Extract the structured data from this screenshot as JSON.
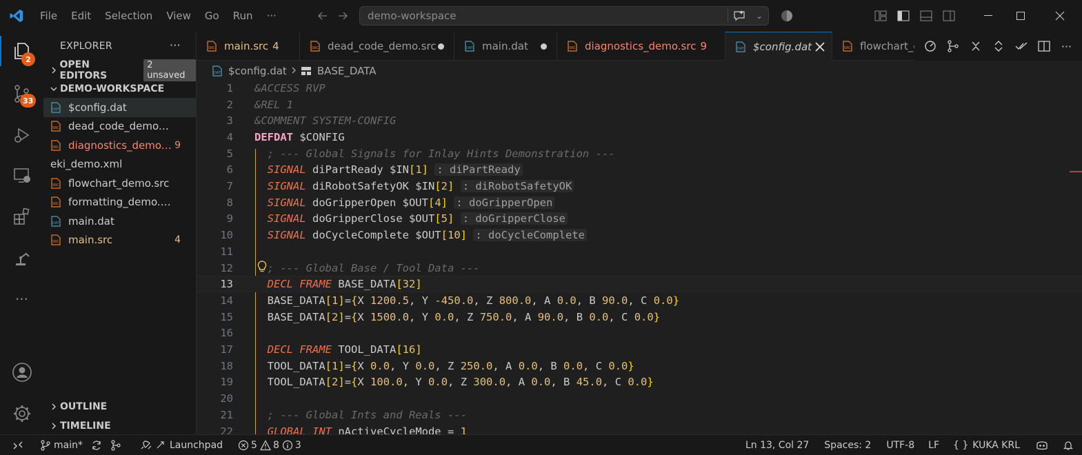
{
  "titlebar": {
    "menu": [
      "File",
      "Edit",
      "Selection",
      "View",
      "Go",
      "Run",
      "···"
    ],
    "search_text": "demo-workspace"
  },
  "activity": {
    "explorer_badge": "2",
    "scm_badge": "33"
  },
  "sidebar": {
    "title": "EXPLORER",
    "more": "···",
    "open_editors": "OPEN EDITORS",
    "unsaved": "2 unsaved",
    "workspace": "DEMO-WORKSPACE",
    "files": [
      {
        "name": "$config.dat",
        "type": "dat",
        "state": "sel",
        "count": ""
      },
      {
        "name": "dead_code_demo.src",
        "type": "src",
        "state": "",
        "count": ""
      },
      {
        "name": "diagnostics_demo....",
        "type": "src",
        "state": "err",
        "count": "9"
      },
      {
        "name": "eki_demo.xml",
        "type": "none",
        "state": "",
        "count": ""
      },
      {
        "name": "flowchart_demo.src",
        "type": "src",
        "state": "",
        "count": ""
      },
      {
        "name": "formatting_demo.src",
        "type": "src",
        "state": "",
        "count": ""
      },
      {
        "name": "main.dat",
        "type": "dat",
        "state": "",
        "count": ""
      },
      {
        "name": "main.src",
        "type": "src",
        "state": "mod",
        "count": "4"
      }
    ],
    "outline": "OUTLINE",
    "timeline": "TIMELINE"
  },
  "tabs": [
    {
      "label": "main.src",
      "type": "src",
      "state": "mod",
      "count": "4",
      "dirty": false
    },
    {
      "label": "dead_code_demo.src",
      "type": "src",
      "state": "",
      "count": "",
      "dirty": true
    },
    {
      "label": "main.dat",
      "type": "dat",
      "state": "",
      "count": "",
      "dirty": true
    },
    {
      "label": "diagnostics_demo.src",
      "type": "src",
      "state": "err",
      "count": "9",
      "dirty": false
    },
    {
      "label": "$config.dat",
      "type": "dat",
      "state": "active",
      "count": "",
      "dirty": false
    },
    {
      "label": "flowchart_c",
      "type": "src",
      "state": "",
      "count": "",
      "dirty": false
    }
  ],
  "breadcrumb": {
    "file": "$config.dat",
    "symbol": "BASE_DATA"
  },
  "editor": {
    "current_line": 13,
    "lines": [
      {
        "n": "1",
        "tokens": [
          [
            "c-com",
            "&ACCESS RVP"
          ]
        ]
      },
      {
        "n": "2",
        "tokens": [
          [
            "c-com",
            "&REL 1"
          ]
        ]
      },
      {
        "n": "3",
        "tokens": [
          [
            "c-com",
            "&COMMENT SYSTEM-CONFIG"
          ]
        ]
      },
      {
        "n": "4",
        "tokens": [
          [
            "c-kw",
            "DEFDAT"
          ],
          [
            "c-plain",
            " $CONFIG"
          ]
        ]
      },
      {
        "n": "5",
        "tokens": [
          [
            "c-com",
            "  ; --- Global Signals for Inlay Hints Demonstration ---"
          ]
        ]
      },
      {
        "n": "6",
        "tokens": [
          [
            "c-plain",
            "  "
          ],
          [
            "c-key",
            "SIGNAL"
          ],
          [
            "c-plain",
            " diPartReady $IN"
          ],
          [
            "c-br",
            "["
          ],
          [
            "c-num",
            "1"
          ],
          [
            "c-br",
            "]"
          ],
          [
            "c-plain",
            " "
          ],
          [
            "c-hint",
            ": diPartReady"
          ]
        ]
      },
      {
        "n": "7",
        "tokens": [
          [
            "c-plain",
            "  "
          ],
          [
            "c-key",
            "SIGNAL"
          ],
          [
            "c-plain",
            " diRobotSafetyOK $IN"
          ],
          [
            "c-br",
            "["
          ],
          [
            "c-num",
            "2"
          ],
          [
            "c-br",
            "]"
          ],
          [
            "c-plain",
            " "
          ],
          [
            "c-hint",
            ": diRobotSafetyOK"
          ]
        ]
      },
      {
        "n": "8",
        "tokens": [
          [
            "c-plain",
            "  "
          ],
          [
            "c-key",
            "SIGNAL"
          ],
          [
            "c-plain",
            " doGripperOpen $OUT"
          ],
          [
            "c-br",
            "["
          ],
          [
            "c-num",
            "4"
          ],
          [
            "c-br",
            "]"
          ],
          [
            "c-plain",
            " "
          ],
          [
            "c-hint",
            ": doGripperOpen"
          ]
        ]
      },
      {
        "n": "9",
        "tokens": [
          [
            "c-plain",
            "  "
          ],
          [
            "c-key",
            "SIGNAL"
          ],
          [
            "c-plain",
            " doGripperClose $OUT"
          ],
          [
            "c-br",
            "["
          ],
          [
            "c-num",
            "5"
          ],
          [
            "c-br",
            "]"
          ],
          [
            "c-plain",
            " "
          ],
          [
            "c-hint",
            ": doGripperClose"
          ]
        ]
      },
      {
        "n": "10",
        "tokens": [
          [
            "c-plain",
            "  "
          ],
          [
            "c-key",
            "SIGNAL"
          ],
          [
            "c-plain",
            " doCycleComplete $OUT"
          ],
          [
            "c-br",
            "["
          ],
          [
            "c-num",
            "10"
          ],
          [
            "c-br",
            "]"
          ],
          [
            "c-plain",
            " "
          ],
          [
            "c-hint",
            ": doCycleComplete"
          ]
        ]
      },
      {
        "n": "11",
        "tokens": []
      },
      {
        "n": "12",
        "tokens": [
          [
            "c-com",
            "  ; --- Global Base / Tool Data ---"
          ]
        ]
      },
      {
        "n": "13",
        "tokens": [
          [
            "c-plain",
            "  "
          ],
          [
            "c-key",
            "DECL FRAME"
          ],
          [
            "c-plain",
            " BASE_DATA"
          ],
          [
            "c-br",
            "["
          ],
          [
            "c-num",
            "32"
          ],
          [
            "c-br",
            "]"
          ]
        ]
      },
      {
        "n": "14",
        "tokens": [
          [
            "c-plain",
            "  BASE_DATA"
          ],
          [
            "c-br",
            "["
          ],
          [
            "c-num",
            "1"
          ],
          [
            "c-br",
            "]"
          ],
          [
            "c-plain",
            "="
          ],
          [
            "c-br",
            "{"
          ],
          [
            "c-plain",
            "X "
          ],
          [
            "c-num",
            "1200.5"
          ],
          [
            "c-plain",
            ", Y "
          ],
          [
            "c-num",
            "-450.0"
          ],
          [
            "c-plain",
            ", Z "
          ],
          [
            "c-num",
            "800.0"
          ],
          [
            "c-plain",
            ", A "
          ],
          [
            "c-num",
            "0.0"
          ],
          [
            "c-plain",
            ", B "
          ],
          [
            "c-num",
            "90.0"
          ],
          [
            "c-plain",
            ", C "
          ],
          [
            "c-num",
            "0.0"
          ],
          [
            "c-br",
            "}"
          ]
        ]
      },
      {
        "n": "15",
        "tokens": [
          [
            "c-plain",
            "  BASE_DATA"
          ],
          [
            "c-br",
            "["
          ],
          [
            "c-num",
            "2"
          ],
          [
            "c-br",
            "]"
          ],
          [
            "c-plain",
            "="
          ],
          [
            "c-br",
            "{"
          ],
          [
            "c-plain",
            "X "
          ],
          [
            "c-num",
            "1500.0"
          ],
          [
            "c-plain",
            ", Y "
          ],
          [
            "c-num",
            "0.0"
          ],
          [
            "c-plain",
            ", Z "
          ],
          [
            "c-num",
            "750.0"
          ],
          [
            "c-plain",
            ", A "
          ],
          [
            "c-num",
            "90.0"
          ],
          [
            "c-plain",
            ", B "
          ],
          [
            "c-num",
            "0.0"
          ],
          [
            "c-plain",
            ", C "
          ],
          [
            "c-num",
            "0.0"
          ],
          [
            "c-br",
            "}"
          ]
        ]
      },
      {
        "n": "16",
        "tokens": []
      },
      {
        "n": "17",
        "tokens": [
          [
            "c-plain",
            "  "
          ],
          [
            "c-key",
            "DECL FRAME"
          ],
          [
            "c-plain",
            " TOOL_DATA"
          ],
          [
            "c-br",
            "["
          ],
          [
            "c-num",
            "16"
          ],
          [
            "c-br",
            "]"
          ]
        ]
      },
      {
        "n": "18",
        "tokens": [
          [
            "c-plain",
            "  TOOL_DATA"
          ],
          [
            "c-br",
            "["
          ],
          [
            "c-num",
            "1"
          ],
          [
            "c-br",
            "]"
          ],
          [
            "c-plain",
            "="
          ],
          [
            "c-br",
            "{"
          ],
          [
            "c-plain",
            "X "
          ],
          [
            "c-num",
            "0.0"
          ],
          [
            "c-plain",
            ", Y "
          ],
          [
            "c-num",
            "0.0"
          ],
          [
            "c-plain",
            ", Z "
          ],
          [
            "c-num",
            "250.0"
          ],
          [
            "c-plain",
            ", A "
          ],
          [
            "c-num",
            "0.0"
          ],
          [
            "c-plain",
            ", B "
          ],
          [
            "c-num",
            "0.0"
          ],
          [
            "c-plain",
            ", C "
          ],
          [
            "c-num",
            "0.0"
          ],
          [
            "c-br",
            "}"
          ]
        ]
      },
      {
        "n": "19",
        "tokens": [
          [
            "c-plain",
            "  TOOL_DATA"
          ],
          [
            "c-br",
            "["
          ],
          [
            "c-num",
            "2"
          ],
          [
            "c-br",
            "]"
          ],
          [
            "c-plain",
            "="
          ],
          [
            "c-br",
            "{"
          ],
          [
            "c-plain",
            "X "
          ],
          [
            "c-num",
            "100.0"
          ],
          [
            "c-plain",
            ", Y "
          ],
          [
            "c-num",
            "0.0"
          ],
          [
            "c-plain",
            ", Z "
          ],
          [
            "c-num",
            "300.0"
          ],
          [
            "c-plain",
            ", A "
          ],
          [
            "c-num",
            "0.0"
          ],
          [
            "c-plain",
            ", B "
          ],
          [
            "c-num",
            "45.0"
          ],
          [
            "c-plain",
            ", C "
          ],
          [
            "c-num",
            "0.0"
          ],
          [
            "c-br",
            "}"
          ]
        ]
      },
      {
        "n": "20",
        "tokens": []
      },
      {
        "n": "21",
        "tokens": [
          [
            "c-com",
            "  ; --- Global Ints and Reals ---"
          ]
        ]
      },
      {
        "n": "22",
        "tokens": [
          [
            "c-plain",
            "  "
          ],
          [
            "c-key",
            "GLOBAL INT"
          ],
          [
            "c-plain",
            " nActiveCycleMode = "
          ],
          [
            "c-num",
            "1"
          ]
        ]
      }
    ]
  },
  "statusbar": {
    "branch": "main*",
    "launchpad": "Launchpad",
    "errors": "5",
    "warnings": "8",
    "infos": "3",
    "position": "Ln 13, Col 27",
    "spaces": "Spaces: 2",
    "encoding": "UTF-8",
    "eol": "LF",
    "language": "KUKA KRL"
  }
}
